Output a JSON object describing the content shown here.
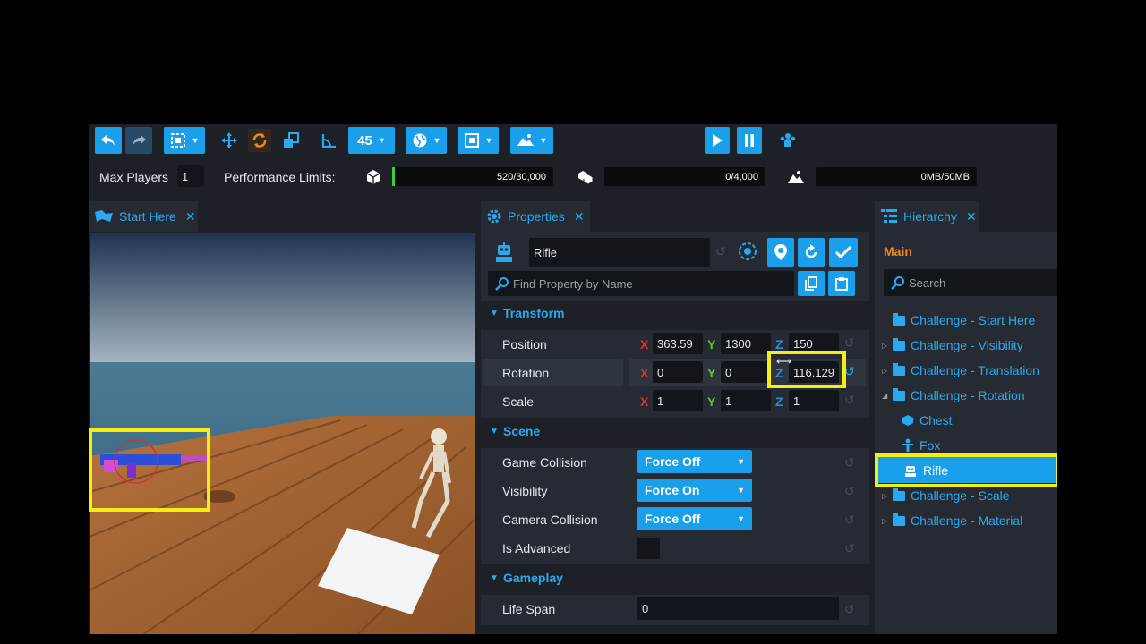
{
  "toolbar": {
    "snap_angle": "45",
    "max_players_label": "Max Players",
    "max_players_value": "1",
    "perf_label": "Performance Limits:",
    "perf_objects": "520/30,000",
    "perf_objects_fill": 0.017,
    "perf_instances": "0/4,000",
    "perf_memory": "0MB/50MB"
  },
  "viewport": {
    "tab_label": "Start Here"
  },
  "properties": {
    "tab_label": "Properties",
    "object_name": "Rifle",
    "search_placeholder": "Find Property by Name",
    "transform": {
      "title": "Transform",
      "position_label": "Position",
      "rotation_label": "Rotation",
      "scale_label": "Scale",
      "position": {
        "x": "363.59",
        "y": "1300",
        "z": "150"
      },
      "rotation": {
        "x": "0",
        "y": "0",
        "z": "116.129"
      },
      "scale": {
        "x": "1",
        "y": "1",
        "z": "1"
      },
      "x": "X",
      "y": "Y",
      "z": "Z"
    },
    "scene": {
      "title": "Scene",
      "game_collision_label": "Game Collision",
      "game_collision_value": "Force Off",
      "visibility_label": "Visibility",
      "visibility_value": "Force On",
      "camera_collision_label": "Camera Collision",
      "camera_collision_value": "Force Off",
      "is_advanced_label": "Is Advanced"
    },
    "gameplay": {
      "title": "Gameplay",
      "life_span_label": "Life Span",
      "life_span_value": "0"
    }
  },
  "hierarchy": {
    "tab_label": "Hierarchy",
    "root": "Main",
    "search_placeholder": "Search",
    "items": [
      {
        "label": "Challenge - Start Here"
      },
      {
        "label": "Challenge - Visibility"
      },
      {
        "label": "Challenge - Translation"
      },
      {
        "label": "Challenge - Rotation"
      },
      {
        "label": "Chest"
      },
      {
        "label": "Fox"
      },
      {
        "label": "Rifle"
      },
      {
        "label": "Challenge - Scale"
      },
      {
        "label": "Challenge - Material"
      }
    ]
  },
  "colors": {
    "accent": "#1aa0ea",
    "panel": "#1d2127",
    "highlight": "#f4ee12",
    "section": "#2aa9f0"
  }
}
